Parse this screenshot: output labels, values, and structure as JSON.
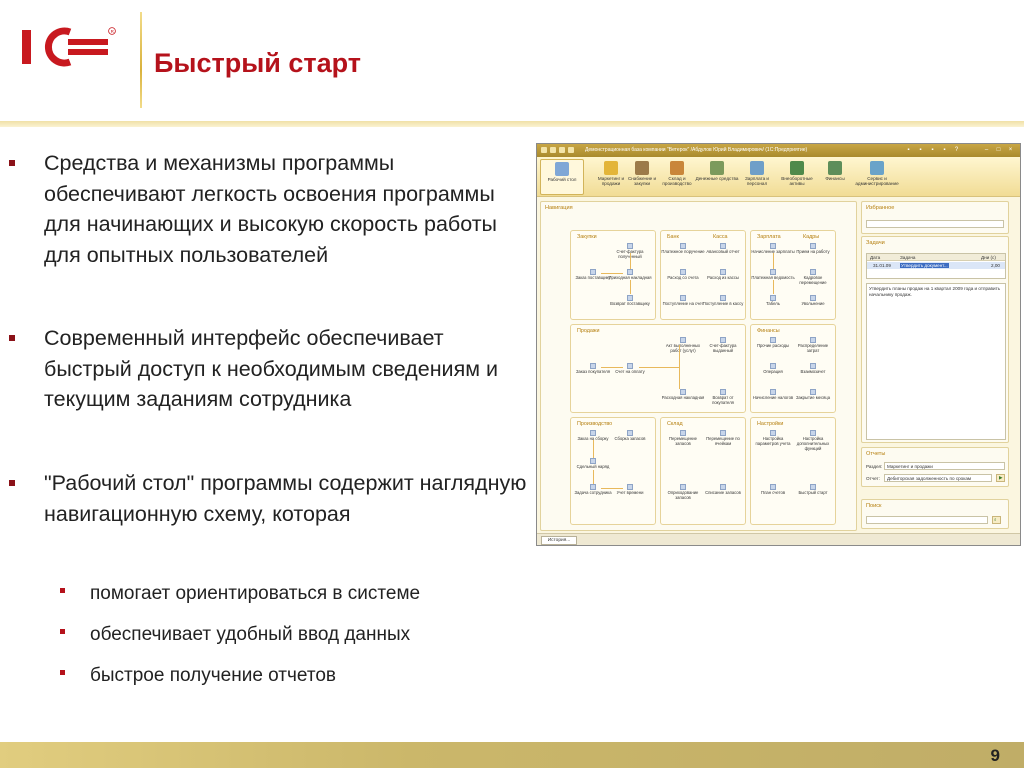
{
  "slide": {
    "title": "Быстрый старт",
    "page_number": "9",
    "logo_text": "1С"
  },
  "bullets": [
    "Средства и механизмы программы обеспечивают легкость освоения программы для начинающих и высокую скорость работы для опытных пользователей",
    "Современный интерфейс обеспечивает быстрый доступ к необходимым сведениям и текущим заданиям сотрудника",
    "\"Рабочий стол\" программы содержит наглядную навигационную схему, которая"
  ],
  "sub_bullets": [
    "помогает ориентироваться в системе",
    "обеспечивает удобный ввод данных",
    "быстрое получение отчетов"
  ],
  "colors": {
    "brand_red": "#b5121b",
    "accent_gold": "#d9b23c",
    "footer_gold": "#cbb76a"
  },
  "app": {
    "window_title": "Демонстрационная база компании \"Ветерок\" /Абдулов Юрий Владимирович/ (1С:Предприятие)",
    "toolbar": [
      {
        "label": "Рабочий стол",
        "icon": "desktop-icon",
        "color": "#7fa7d6"
      },
      {
        "label": "Маркетинг и продажи",
        "icon": "marketing-icon",
        "color": "#e3b53a"
      },
      {
        "label": "Снабжение и закупки",
        "icon": "supply-icon",
        "color": "#9c7b4a"
      },
      {
        "label": "Склад и производство",
        "icon": "warehouse-icon",
        "color": "#c9863a"
      },
      {
        "label": "Денежные средства",
        "icon": "money-icon",
        "color": "#7c9a5c"
      },
      {
        "label": "Зарплата и персонал",
        "icon": "salary-icon",
        "color": "#6f9fc8"
      },
      {
        "label": "Внеоборотные активы",
        "icon": "assets-icon",
        "color": "#4f8a4a"
      },
      {
        "label": "Финансы",
        "icon": "finance-icon",
        "color": "#5e8e5a"
      },
      {
        "label": "Сервис и администрирование",
        "icon": "service-icon",
        "color": "#6aa3c9"
      }
    ],
    "navigation": {
      "title": "Навигация",
      "blocks": {
        "zakupki": {
          "title": "Закупки",
          "items": [
            "Счет-фактура полученный",
            "Заказ поставщику",
            "Приходная накладная",
            "Возврат поставщику"
          ]
        },
        "bank": {
          "title": "Банк",
          "items": [
            "Платежное поручение",
            "Расход со счета",
            "Поступление на счет"
          ]
        },
        "kassa": {
          "title": "Касса",
          "items": [
            "Авансовый отчет",
            "Расход из кассы",
            "Поступление в кассу"
          ]
        },
        "zarplata": {
          "title": "Зарплата",
          "items": [
            "Начисление зарплаты",
            "Платежная ведомость",
            "Табель"
          ]
        },
        "kadry": {
          "title": "Кадры",
          "items": [
            "Прием на работу",
            "Кадровое перемещение",
            "Увольнение"
          ]
        },
        "prodazhi": {
          "title": "Продажи",
          "items": [
            "Акт выполненных работ (услуг)",
            "Счет-фактура выданный",
            "Заказ покупателя",
            "Счет на оплату",
            "Расходная накладная",
            "Возврат от покупателя"
          ]
        },
        "finansy": {
          "title": "Финансы",
          "items": [
            "Прочие расходы",
            "Распределение затрат",
            "Операция",
            "Взаимозачет",
            "Начисление налогов",
            "Закрытие месяца"
          ]
        },
        "proizvodstvo": {
          "title": "Производство",
          "items": [
            "Заказ на сборку",
            "Сборка запасов",
            "Сдельный наряд",
            "Задача сотрудника",
            "Учет времени"
          ]
        },
        "sklad": {
          "title": "Склад",
          "items": [
            "Перемещение запасов",
            "Перемещение по ячейкам",
            "Оприходование запасов",
            "Списание запасов"
          ]
        },
        "nastroiki": {
          "title": "Настройки",
          "items": [
            "Настройка параметров учета",
            "Настройка дополнительных функций",
            "План счетов",
            "Быстрый старт"
          ]
        }
      }
    },
    "favorites": {
      "title": "Избранное"
    },
    "tasks": {
      "title": "Задачи",
      "columns": [
        "Дата",
        "Задача",
        "Дни (с)"
      ],
      "rows": [
        {
          "date": "31.01.09",
          "task": "Утвердить документ...",
          "days": "2,00"
        }
      ],
      "description": "Утвердить планы продаж на 1 квартал 2009 года и отправить начальнику продаж."
    },
    "reports": {
      "title": "Отчеты",
      "section_label": "Раздел:",
      "section_value": "Маркетинг и продажи",
      "report_label": "Отчет:",
      "report_value": "Дебиторская задолженность по срокам"
    },
    "search": {
      "title": "Поиск",
      "value": ""
    },
    "status_tab": "История..."
  }
}
